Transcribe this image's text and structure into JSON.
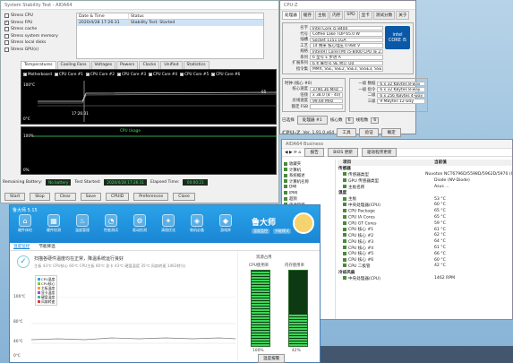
{
  "stress_window": {
    "title": "System Stability Test - AIDA64",
    "options": [
      {
        "label": "Stress CPU",
        "checked": false
      },
      {
        "label": "Stress FPU",
        "checked": true
      },
      {
        "label": "Stress cache",
        "checked": false
      },
      {
        "label": "Stress system memory",
        "checked": false
      },
      {
        "label": "Stress local disks",
        "checked": false
      },
      {
        "label": "Stress GPU(s)",
        "checked": false
      }
    ],
    "log_headers": [
      "Date & Time",
      "Status"
    ],
    "log_rows": [
      {
        "time": "2020/4/28 17:26:31",
        "status": "Stability Test: Started"
      }
    ],
    "tabs": [
      "Temperatures",
      "Cooling Fans",
      "Voltages",
      "Powers",
      "Clocks",
      "Unified",
      "Statistics"
    ],
    "legend": [
      "Motherboard",
      "CPU Core #1",
      "CPU Core #2",
      "CPU Core #3",
      "CPU Core #4",
      "CPU Core #5",
      "CPU Core #6"
    ],
    "temp_top": "100°C",
    "temp_bottom": "0°C",
    "time_label": "17:26:31",
    "temp_value": "65",
    "usage_title": "CPU Usage",
    "usage_top": "100%",
    "usage_bottom": "0%",
    "status": {
      "battery_label": "Remaining Battery:",
      "battery_value": "No battery",
      "started_label": "Test Started:",
      "started_value": "2020/4/28 17:26:31",
      "elapsed_label": "Elapsed Time:",
      "elapsed_value": "00:00:21"
    },
    "buttons": [
      "Start",
      "Stop",
      "Clear",
      "Save",
      "CPUID",
      "Preferences",
      "Close"
    ]
  },
  "cpuz": {
    "title": "CPU-Z",
    "tabs": [
      "处理器",
      "缓存",
      "主板",
      "内存",
      "SPD",
      "显卡",
      "测试分数",
      "关于"
    ],
    "rows": [
      {
        "k": "名字",
        "v": "Intel Core i5 8400"
      },
      {
        "k": "代号",
        "v": "Coffee Lake      TDP 65.0 W"
      },
      {
        "k": "插槽",
        "v": "Socket 1151 LGA"
      },
      {
        "k": "工艺",
        "v": "14 纳米     核心电压 0.984 V"
      },
      {
        "k": "规格",
        "v": "Intel(R) Core(TM) i5-8400 CPU @ 2.80GHz"
      },
      {
        "k": "系列",
        "v": "6    型号 E   步进 A"
      },
      {
        "k": "扩展系列",
        "v": "6    扩展型号 9E   修订 U0"
      },
      {
        "k": "指令集",
        "v": "MMX, SSE, SSE2, SSE3, SSSE3, SSE4.1, SSE4.2, EM64T, VT-x, AES, AVX, AVX2"
      }
    ],
    "clock_title": "时钟 (核心 #0)",
    "clock_rows": [
      {
        "k": "核心速度",
        "v": "3790.36 MHz"
      },
      {
        "k": "倍频",
        "v": "x 38.0 (8 - 40)"
      },
      {
        "k": "总线速度",
        "v": "99.69 MHz"
      },
      {
        "k": "额定 FSB",
        "v": ""
      }
    ],
    "cache_rows": [
      {
        "k": "一级 数据",
        "v": "6 x 32 KBytes   8-way"
      },
      {
        "k": "一级 指令",
        "v": "6 x 32 KBytes   8-way"
      },
      {
        "k": "二级",
        "v": "6 x 256 KBytes  4-way"
      },
      {
        "k": "三级",
        "v": "9 MBytes        12-way"
      }
    ],
    "selected_label": "已选择",
    "selected_value": "处理器 #1",
    "cores_label": "核心数",
    "cores_value": "6",
    "threads_label": "线程数",
    "threads_value": "6",
    "version": "Ver. 1.91.0.x64",
    "tools": "工具",
    "verify": "验证",
    "ok": "确定",
    "intel_line1": "intel",
    "intel_line2": "CORE i5",
    "brand": "CPU-Z"
  },
  "aida": {
    "title": "AIDA64 Business",
    "tools": [
      "报告",
      "BIOS 更新",
      "驱动程序更新"
    ],
    "tree": [
      "收藏夹",
      "计算机",
      "系统概述",
      "计算机名称",
      "DMI",
      "IPMI",
      "超频",
      "电源管理",
      "便携式计算机",
      "传感器"
    ],
    "sections": [
      {
        "name": "传感器",
        "rows": [
          {
            "f": "传感器类型",
            "v": "Nuvoton NCT6796D/5598D/5962D/5970 (I"
          },
          {
            "f": "GPU 传感器类型",
            "v": "Diode (NV-Diode)"
          },
          {
            "f": "主板名称",
            "v": "Asus ..."
          }
        ]
      },
      {
        "name": "温度",
        "rows": [
          {
            "f": "主板",
            "v": "53 °C"
          },
          {
            "f": "中央处理器(CPU)",
            "v": "60 °C"
          },
          {
            "f": "CPU Package",
            "v": "65 °C"
          },
          {
            "f": "CPU IA Cores",
            "v": "65 °C"
          },
          {
            "f": "CPU GT Cores",
            "v": "59 °C"
          },
          {
            "f": "CPU 核心 #1",
            "v": "61 °C"
          },
          {
            "f": "CPU 核心 #2",
            "v": "62 °C"
          },
          {
            "f": "CPU 核心 #3",
            "v": "64 °C"
          },
          {
            "f": "CPU 核心 #4",
            "v": "61 °C"
          },
          {
            "f": "CPU 核心 #5",
            "v": "66 °C"
          },
          {
            "f": "CPU 核心 #6",
            "v": "60 °C"
          },
          {
            "f": "CPU 二极管",
            "v": "42 °C"
          }
        ]
      },
      {
        "name": "冷却风扇",
        "rows": [
          {
            "f": "中央处理器(CPU)",
            "v": "1462 RPM"
          }
        ]
      }
    ],
    "col_field": "项目",
    "col_value": "当前值"
  },
  "ludashi": {
    "title": "鲁大师 5.15",
    "nav": [
      {
        "label": "硬件体检",
        "icon": "⌂"
      },
      {
        "label": "硬件检测",
        "icon": "▦"
      },
      {
        "label": "温度管理",
        "icon": "♨"
      },
      {
        "label": "性能测试",
        "icon": "◔"
      },
      {
        "label": "驱动检测",
        "icon": "⚙"
      },
      {
        "label": "清理优化",
        "icon": "✦"
      },
      {
        "label": "装机必备",
        "icon": "◈"
      },
      {
        "label": "游戏库",
        "icon": "◆"
      }
    ],
    "brand": "鲁大师",
    "sub": [
      "温度监控",
      "节能模式"
    ],
    "tabs": [
      "温度监控",
      "节能降温"
    ],
    "msg": "扫描各硬件温度均在正常，降温系统运行良好",
    "msg2": "主板 43℃   CPU核心 66℃   CPU主板 60℃   显卡 43℃   硬盘温度 35℃   风扇转速 1462转/分",
    "y_top": "100℃",
    "y_mid": "80℃",
    "y_low": "40℃",
    "y_zero": "0℃",
    "legend": [
      "CPU温度",
      "CPU核心",
      "主板温度",
      "显卡温度",
      "硬盘温度",
      "风扇转速"
    ],
    "panel_title": "资源占用",
    "cpu_label": "CPU使用率",
    "cpu_value": "100%",
    "mem_label": "内存使用率",
    "mem_value": "42%",
    "mem_fraction": 0.42,
    "btn": "温度报警"
  },
  "colors": {
    "accent": "#1a86d4",
    "graph_green": "#3fd35a"
  }
}
